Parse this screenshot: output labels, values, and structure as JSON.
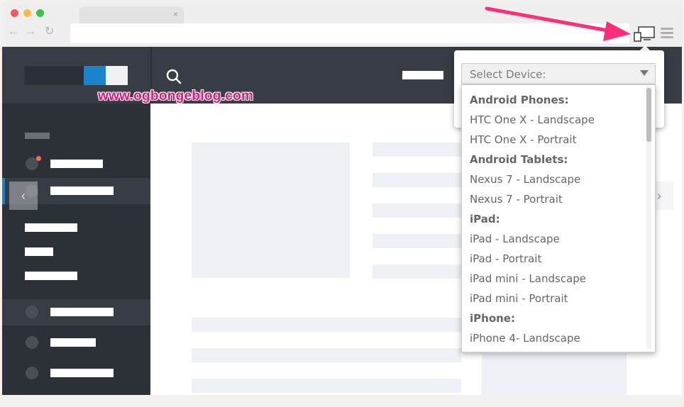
{
  "watermark": "www.ogbongeblog.com",
  "browser": {
    "tab_close": "×",
    "nav": {
      "back": "←",
      "forward": "→",
      "reload": "↻"
    }
  },
  "content": {
    "next_arrow": "›",
    "prev_arrow": "‹"
  },
  "device_selector": {
    "placeholder": "Select Device:",
    "options": [
      {
        "label": "Android Phones:",
        "group": true
      },
      {
        "label": "HTC One X - Landscape",
        "group": false
      },
      {
        "label": "HTC One X - Portrait",
        "group": false
      },
      {
        "label": "Android Tablets:",
        "group": true
      },
      {
        "label": "Nexus 7 - Landscape",
        "group": false
      },
      {
        "label": "Nexus 7 - Portrait",
        "group": false
      },
      {
        "label": "iPad:",
        "group": true
      },
      {
        "label": "iPad - Landscape",
        "group": false
      },
      {
        "label": "iPad - Portrait",
        "group": false
      },
      {
        "label": "iPad mini - Landscape",
        "group": false
      },
      {
        "label": "iPad mini - Portrait",
        "group": false
      },
      {
        "label": "iPhone:",
        "group": true
      },
      {
        "label": "iPhone 4- Landscape",
        "group": false
      }
    ]
  },
  "colors": {
    "accent_blue": "#1a83cc",
    "annotation_pink": "#ff2e78",
    "watermark_pink": "#e4117f",
    "notification_dot": "#ff6a4d"
  }
}
